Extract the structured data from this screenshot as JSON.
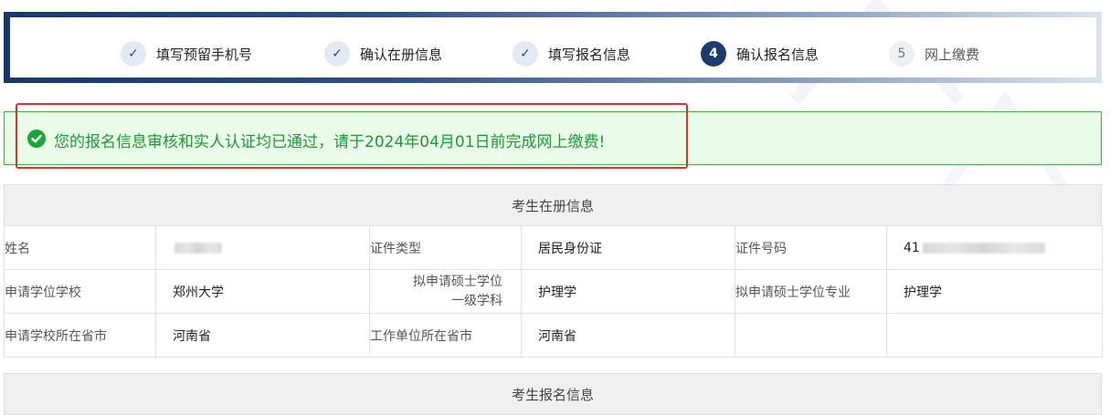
{
  "steps": [
    {
      "marker": "✓",
      "label": "填写预留手机号",
      "status": "done"
    },
    {
      "marker": "✓",
      "label": "确认在册信息",
      "status": "done"
    },
    {
      "marker": "✓",
      "label": "填写报名信息",
      "status": "done"
    },
    {
      "marker": "4",
      "label": "确认报名信息",
      "status": "active"
    },
    {
      "marker": "5",
      "label": "网上缴费",
      "status": "pending"
    }
  ],
  "alert": {
    "icon": "check-circle-icon",
    "message": "您的报名信息审核和实人认证均已通过，请于2024年04月01日前完成网上缴费!"
  },
  "registered_info": {
    "title": "考生在册信息",
    "rows": [
      {
        "l1": "姓名",
        "v1": "",
        "l2": "证件类型",
        "v2": "居民身份证",
        "l3": "证件号码",
        "v3": "41"
      },
      {
        "l1": "申请学位学校",
        "v1": "郑州大学",
        "l2a": "拟申请硕士学位",
        "l2b": "一级学科",
        "v2": "护理学",
        "l3": "拟申请硕士学位专业",
        "v3": "护理学"
      },
      {
        "l1": "申请学校所在省市",
        "v1": "河南省",
        "l2": "工作单位所在省市",
        "v2": "河南省",
        "l3": "",
        "v3": ""
      }
    ]
  },
  "apply_info": {
    "title": "考生报名信息"
  },
  "colors": {
    "primary": "#1c3c6e",
    "success_text": "#1e9a32",
    "success_bg": "#e9fce9",
    "highlight": "#e0322a"
  }
}
